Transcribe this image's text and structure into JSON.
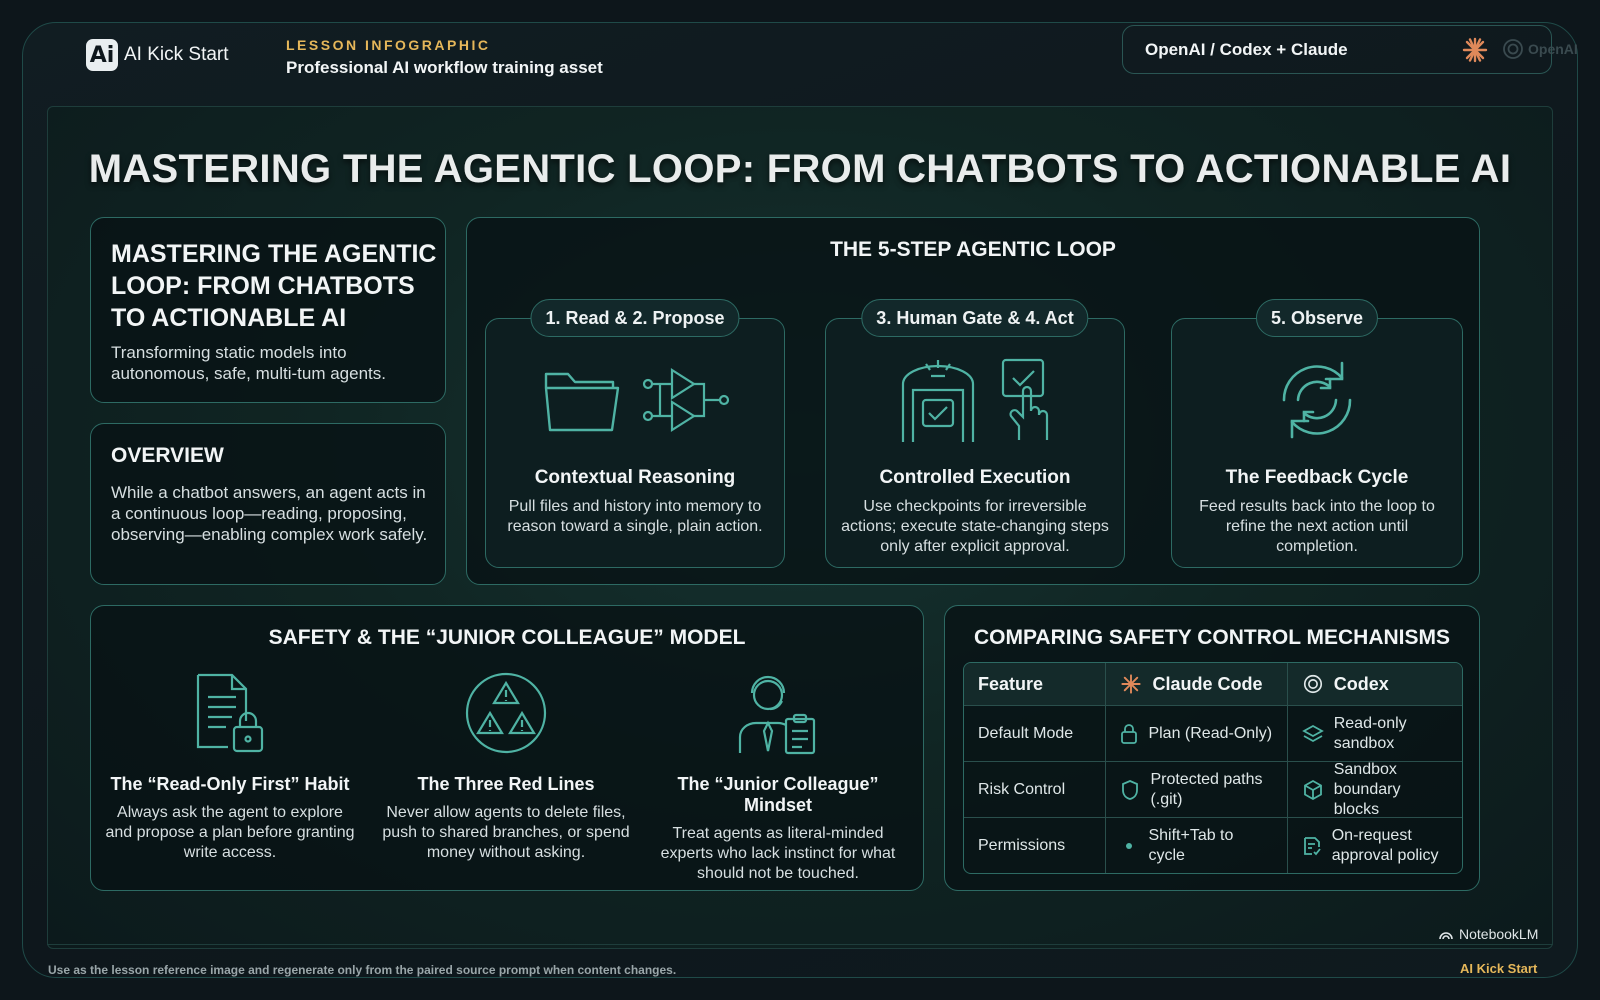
{
  "header": {
    "brand": "AI Kick Start",
    "brand_mark": "Ai",
    "lesson_label": "LESSON INFOGRAPHIC",
    "lesson_subtitle": "Professional AI workflow training asset",
    "platform": "OpenAI / Codex + Claude",
    "openai_mark": "OpenAI"
  },
  "main_title": "MASTERING THE AGENTIC LOOP: FROM CHATBOTS TO ACTIONABLE AI",
  "intro": {
    "title": "MASTERING THE AGENTIC LOOP: FROM CHATBOTS TO ACTIONABLE AI",
    "subtitle": "Transforming static models into autonomous, safe, multi-tum agents."
  },
  "overview": {
    "title": "OVERVIEW",
    "text": "While a chatbot answers, an agent acts in a continuous loop—reading, proposing, observing—enabling complex work safely."
  },
  "loop": {
    "title": "THE 5-STEP AGENTIC LOOP",
    "steps": [
      {
        "pill": "1. Read & 2. Propose",
        "title": "Contextual Reasoning",
        "text": "Pull files and history into memory to reason toward a single, plain action.",
        "icons": [
          "folder-icon",
          "logic-gates-icon"
        ]
      },
      {
        "pill": "3. Human Gate & 4. Act",
        "title": "Controlled Execution",
        "text": "Use checkpoints for irreversible actions; execute state-changing steps only after explicit approval.",
        "icons": [
          "checkpoint-gate-icon",
          "tap-approve-icon"
        ]
      },
      {
        "pill": "5. Observe",
        "title": "The Feedback Cycle",
        "text": "Feed results back into the loop to refine the next action until completion.",
        "icons": [
          "refresh-cycle-icon"
        ]
      }
    ]
  },
  "safety": {
    "title": "SAFETY & THE “JUNIOR COLLEAGUE” MODEL",
    "items": [
      {
        "title": "The “Read-Only First” Habit",
        "text": "Always ask the agent to explore and propose a plan before granting write access.",
        "icon": "locked-document-icon"
      },
      {
        "title": "The Three Red Lines",
        "text": "Never allow agents to delete files, push to shared branches, or spend money without asking.",
        "icon": "warning-triangles-icon"
      },
      {
        "title": "The “Junior Colleague” Mindset",
        "text": "Treat agents as literal-minded experts who lack instinct for what should not be touched.",
        "icon": "colleague-clipboard-icon"
      }
    ]
  },
  "comparison": {
    "title": "COMPARING SAFETY CONTROL MECHANISMS",
    "headers": [
      "Feature",
      "Claude Code",
      "Codex"
    ],
    "rows": [
      {
        "feature": "Default Mode",
        "claude": "Plan (Read-Only)",
        "codex": "Read-only sandbox",
        "claude_icon": "lock-icon",
        "codex_icon": "layers-icon"
      },
      {
        "feature": "Risk Control",
        "claude": "Protected paths (.git)",
        "codex": "Sandbox boundary blocks",
        "claude_icon": "shield-icon",
        "codex_icon": "cube-icon"
      },
      {
        "feature": "Permissions",
        "claude": "Shift+Tab to cycle",
        "codex": "On-request approval policy",
        "claude_icon": "dot-icon",
        "codex_icon": "approval-policy-icon"
      }
    ]
  },
  "watermark": "NotebookLM",
  "footer": {
    "note": "Use as the lesson reference image and regenerate only from the paired source prompt when content changes.",
    "brand": "AI Kick Start"
  },
  "colors": {
    "accent_gold": "#e5b75a",
    "teal_border": "#2d6a63",
    "icon_teal": "#4fb3a4",
    "claude_orange": "#e0895a"
  }
}
